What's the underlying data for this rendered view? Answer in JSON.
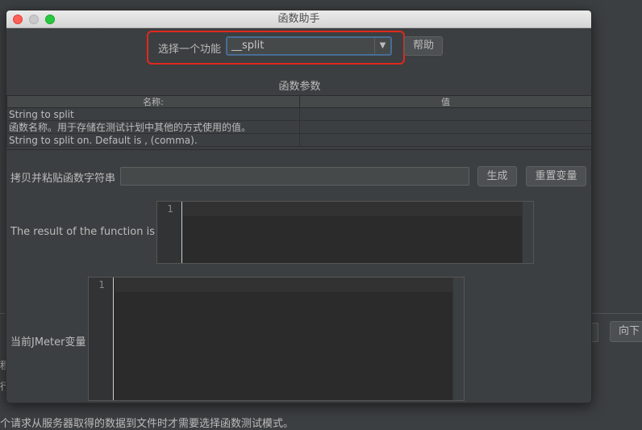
{
  "background": {
    "side_text_1": "程",
    "side_text_2": "行",
    "partial_button": "向下",
    "bottom_text": "个请求从服务器取得的数据到文件时才需要选择函数测试模式。"
  },
  "window": {
    "title": "函数助手"
  },
  "function_select": {
    "label": "选择一个功能",
    "selected": "__split",
    "help_label": "帮助"
  },
  "params": {
    "section_title": "函数参数",
    "columns": [
      "名称:",
      "值"
    ],
    "rows": [
      {
        "name": "String to split",
        "value": ""
      },
      {
        "name": "函数名称。用于存储在测试计划中其他的方式使用的值。",
        "value": ""
      },
      {
        "name": "String to split on. Default is , (comma).",
        "value": ""
      }
    ]
  },
  "copy_paste": {
    "label": "拷贝并粘贴函数字符串",
    "value": "",
    "generate_label": "生成",
    "reset_label": "重置变量"
  },
  "result": {
    "label": "The result of the function is",
    "line_number": "1"
  },
  "jmeter_vars": {
    "label": "当前JMeter变量",
    "line_number": "1"
  },
  "colors": {
    "highlight": "#e0281e",
    "select_focus": "#466d94",
    "close": "#fe5f57",
    "maximize": "#28c840"
  }
}
